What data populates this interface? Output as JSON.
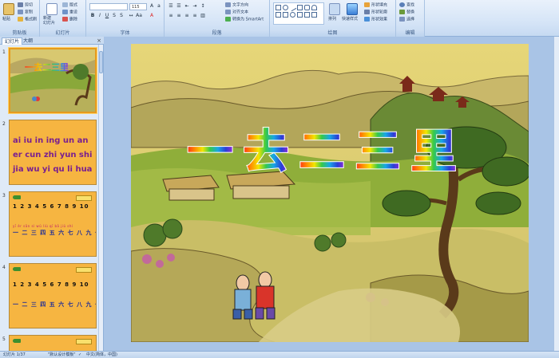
{
  "ribbon": {
    "clipboard": {
      "label": "剪贴板",
      "paste": "粘贴",
      "cut": "剪切",
      "copy": "复制",
      "format_painter": "格式刷"
    },
    "slides": {
      "label": "幻灯片",
      "new_slide": "新建\n幻灯片",
      "layout": "版式",
      "reset": "重设",
      "delete": "删除"
    },
    "font": {
      "label": "字体",
      "font_size": "115"
    },
    "paragraph": {
      "label": "段落",
      "text_direction": "文字方向",
      "align_text": "对齐文本",
      "smartart": "转换为 SmartArt"
    },
    "drawing": {
      "label": "绘图",
      "arrange": "排列",
      "quick_styles": "快速样式",
      "shape_fill": "形状填充",
      "shape_outline": "形状轮廓",
      "shape_effects": "形状效果"
    },
    "editing": {
      "label": "编辑",
      "find": "查找",
      "replace": "替换",
      "select": "选择"
    }
  },
  "panel": {
    "tab_slides": "幻灯片",
    "tab_outline": "大纲",
    "close": "×"
  },
  "thumbs": [
    {
      "num": "1",
      "title": "一去二三里"
    },
    {
      "num": "2",
      "rows": [
        "ai iu in ing un an",
        "er cun zhi yun shi",
        "jia wu yi qu li hua"
      ]
    },
    {
      "num": "3",
      "numbers": "1 2 3 4 5 6 7 8 9 10",
      "pinyin": "yī èr sān sì wǔ liù qī bā jiǔ shí",
      "hanzi": "一 二 三 四 五 六 七 八 九 十"
    },
    {
      "num": "4",
      "numbers": "1 2 3 4 5 6 7 8 9 10",
      "hanzi": "一 二 三 四 五 六 七 八 九 十"
    },
    {
      "num": "5"
    }
  ],
  "slide": {
    "title_chars": [
      "一",
      "去",
      "二",
      "三",
      "里"
    ]
  },
  "status": {
    "slide_info": "幻灯片 1/37",
    "theme": "\"默认设计模板\"",
    "language": "中文(简体，中国)"
  },
  "colors": {
    "title_gradient": [
      "#ff2a1a",
      "#ff8a00",
      "#f2e600",
      "#36c94a",
      "#18a6e6",
      "#2a3fd6",
      "#9a2ad6"
    ]
  }
}
